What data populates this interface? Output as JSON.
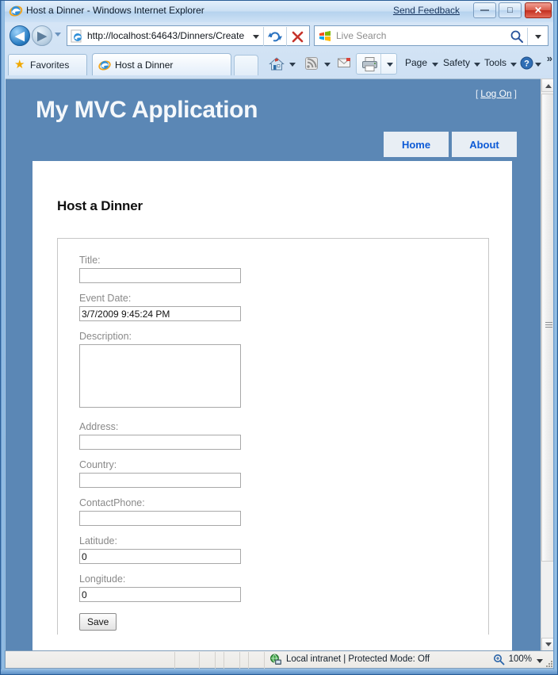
{
  "window": {
    "title": "Host a Dinner - Windows Internet Explorer",
    "send_feedback": "Send Feedback",
    "minimize_label": "—",
    "maximize_label": "□",
    "close_label": "✕"
  },
  "browser": {
    "back_glyph": "◀",
    "forward_glyph": "▶",
    "address_url": "http://localhost:64643/Dinners/Create",
    "search_placeholder": "Live Search",
    "favorites_label": "Favorites",
    "tab_label": "Host a Dinner",
    "toolbar": {
      "page_menu": "Page",
      "safety_menu": "Safety",
      "tools_menu": "Tools",
      "more_chevron": "»"
    }
  },
  "page": {
    "site_title": "My MVC Application",
    "logon_bracket_open": "[",
    "logon_link": "Log On",
    "logon_bracket_close": "]",
    "nav_tabs": [
      {
        "label": "Home"
      },
      {
        "label": "About"
      }
    ],
    "heading": "Host a Dinner",
    "fields": [
      {
        "label": "Title:",
        "value": "",
        "type": "text"
      },
      {
        "label": "Event Date:",
        "value": "3/7/2009 9:45:24 PM",
        "type": "text"
      },
      {
        "label": "Description:",
        "value": "",
        "type": "textarea"
      },
      {
        "label": "Address:",
        "value": "",
        "type": "text"
      },
      {
        "label": "Country:",
        "value": "",
        "type": "text"
      },
      {
        "label": "ContactPhone:",
        "value": "",
        "type": "text"
      },
      {
        "label": "Latitude:",
        "value": "0",
        "type": "text"
      },
      {
        "label": "Longitude:",
        "value": "0",
        "type": "text"
      }
    ],
    "save_label": "Save"
  },
  "status": {
    "zone_text": "Local intranet | Protected Mode: Off",
    "zoom_level": "100%"
  },
  "colors": {
    "header_blue": "#5b87b5",
    "nav_tab_bg": "#e8eef4",
    "nav_tab_text": "#0d5ad6",
    "content_bg": "#ffffff",
    "label_gray": "#898989"
  }
}
